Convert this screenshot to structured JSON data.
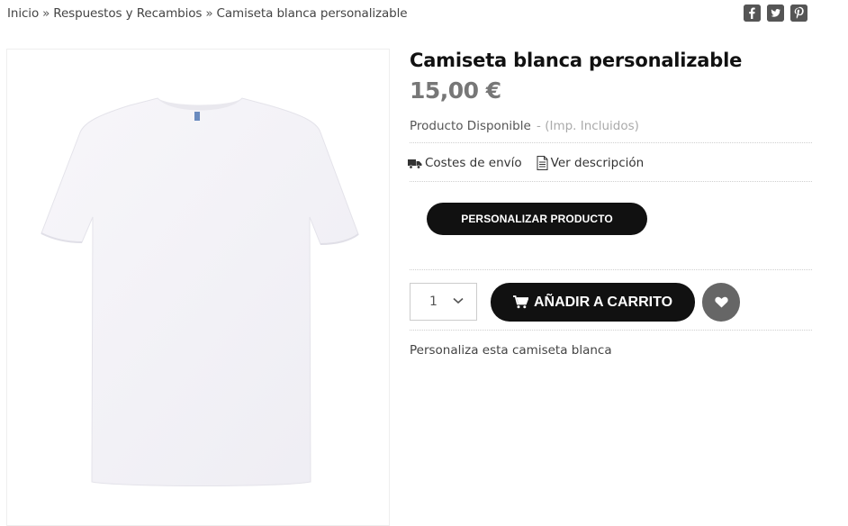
{
  "breadcrumb": {
    "items": [
      "Inicio",
      "Respuestos y Recambios"
    ],
    "separator": "»",
    "current": "Camiseta blanca personalizable"
  },
  "social": {
    "icons": [
      "facebook-icon",
      "twitter-icon",
      "pinterest-icon"
    ],
    "color": "#555555"
  },
  "product": {
    "title": "Camiseta blanca personalizable",
    "price": "15,00 €",
    "availability": "Producto Disponible",
    "tax_note": "- (Imp. Incluidos)",
    "image_alt": "white-tshirt"
  },
  "links": {
    "shipping": "Costes de envío",
    "description": "Ver descripción"
  },
  "buttons": {
    "personalize": "PERSONALIZAR PRODUCTO",
    "add_to_cart": "AÑADIR A CARRITO"
  },
  "quantity": {
    "value": "1"
  },
  "description": "Personaliza esta camiseta blanca",
  "colors": {
    "button_dark": "#111111",
    "wishlist": "#666666",
    "price": "#777777"
  }
}
